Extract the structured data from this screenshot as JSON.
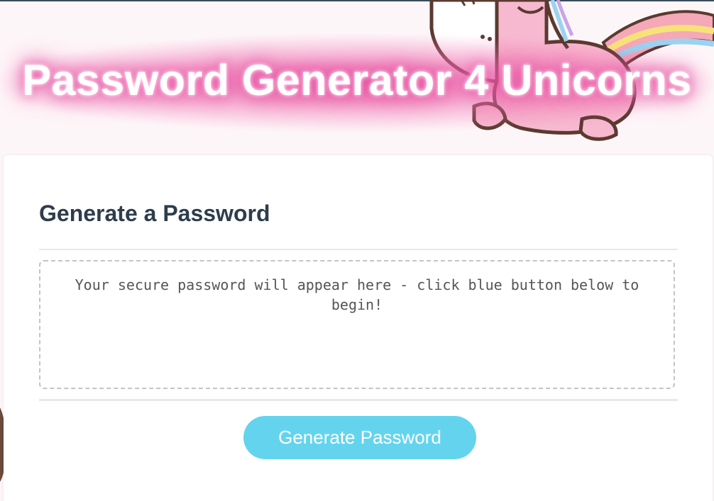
{
  "header": {
    "title": "Password Generator 4 Unicorns"
  },
  "card": {
    "title": "Generate a Password",
    "password_field": {
      "value": "",
      "placeholder": "Your secure password will appear here - click blue button below to begin!"
    },
    "generate_button_label": "Generate Password"
  },
  "colors": {
    "title_glow": "#e3449c",
    "card_title_text": "#2e3d4c",
    "button_background": "#64d4ee",
    "button_text": "#ffffff",
    "dashed_border": "#c2c4c6"
  },
  "icons": {
    "background_art": "unicorn-illustration"
  }
}
